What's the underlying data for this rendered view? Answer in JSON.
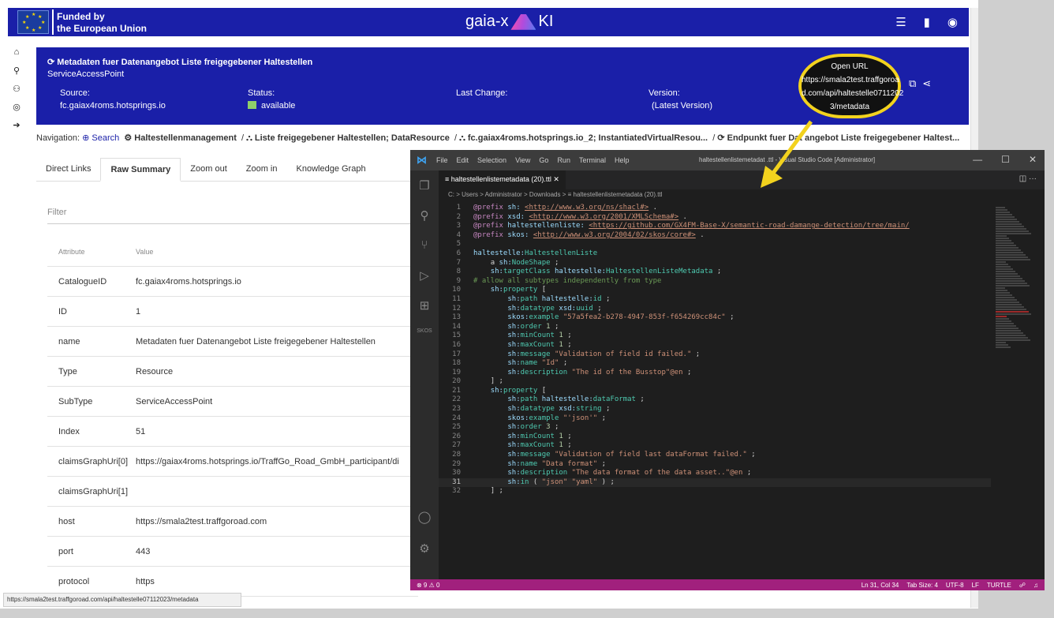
{
  "header": {
    "eu_line1": "Funded by",
    "eu_line2": "the European Union",
    "logo_left": "gaia-x",
    "logo_right": "KI",
    "icons": [
      "menu-icon",
      "document-icon",
      "user-icon"
    ]
  },
  "rail_icons": [
    "home-icon",
    "search-icon",
    "users-icon",
    "user-icon",
    "arrow-right-icon"
  ],
  "banner": {
    "title": "Metadaten fuer Datenangebot Liste freigegebener Haltestellen",
    "subtype": "ServiceAccessPoint",
    "source_label": "Source:",
    "source_value": "fc.gaiax4roms.hotsprings.io",
    "status_label": "Status:",
    "status_value": "available",
    "last_change_label": "Last Change:",
    "version_label": "Version:",
    "version_value": "(Latest Version)",
    "open_url_line1": "Open URL",
    "open_url_line2": "https://smala2test.traffgoroa",
    "open_url_line3": "d.com/api/haltestelle0711202",
    "open_url_line4": "3/metadata"
  },
  "nav": {
    "label": "Navigation:",
    "search": "Search",
    "crumb1": "Haltestellenmanagement",
    "crumb2": "Liste freigegebener Haltestellen; DataResource",
    "crumb3": "fc.gaiax4roms.hotsprings.io_2; InstantiatedVirtualResou...",
    "crumb4": "Endpunkt fuer Dat   angebot Liste freigegebener Haltest..."
  },
  "tabs": [
    "Direct Links",
    "Raw Summary",
    "Zoom out",
    "Zoom in",
    "Knowledge Graph"
  ],
  "filter_placeholder": "Filter",
  "table": {
    "head": [
      "Attribute",
      "Value"
    ],
    "rows": [
      [
        "CatalogueID",
        "fc.gaiax4roms.hotsprings.io"
      ],
      [
        "ID",
        "1"
      ],
      [
        "name",
        "Metadaten fuer Datenangebot Liste freigegebener Haltestellen"
      ],
      [
        "Type",
        "Resource"
      ],
      [
        "SubType",
        "ServiceAccessPoint"
      ],
      [
        "Index",
        "51"
      ],
      [
        "claimsGraphUri[0]",
        "https://gaiax4roms.hotsprings.io/TraffGo_Road_GmbH_participant/di"
      ],
      [
        "claimsGraphUri[1]",
        ""
      ],
      [
        "host",
        "https://smala2test.traffgoroad.com"
      ],
      [
        "port",
        "443"
      ],
      [
        "protocol",
        "https"
      ]
    ]
  },
  "status_url": "https://smala2test.traffgoroad.com/api/haltestelle07112023/metadata",
  "vscode": {
    "menu": [
      "File",
      "Edit",
      "Selection",
      "View",
      "Go",
      "Run",
      "Terminal",
      "Help"
    ],
    "window_title": "haltestellenlistemetadat   .ttl - Visual Studio Code [Administrator]",
    "tab": "haltestellenlistemetadata (20).ttl",
    "breadcrumb": "C: > Users > Administrator > Downloads > ≡ haltestellenlistemetadata (20).ttl",
    "status_left": "⊗ 9 ⚠ 0",
    "status_right": [
      "Ln 31, Col 34",
      "Tab Size: 4",
      "UTF-8",
      "LF",
      "TURTLE"
    ]
  },
  "code_lines": [
    "@prefix sh: <http://www.w3.org/ns/shacl#> .",
    "@prefix xsd: <http://www.w3.org/2001/XMLSchema#> .",
    "@prefix haltestellenliste: <https://github.com/GX4FM-Base-X/semantic-road-damange-detection/tree/main/",
    "@prefix skos: <http://www.w3.org/2004/02/skos/core#> .",
    "",
    "haltestelle:HaltestellenListe",
    "    a sh:NodeShape ;",
    "    sh:targetClass haltestelle:HaltestellenListeMetadata ;",
    "# allow all subtypes independently from type",
    "    sh:property [",
    "        sh:path haltestelle:id ;",
    "        sh:datatype xsd:uuid ;",
    "        skos:example \"57a5fea2-b278-4947-853f-f654269cc84c\" ;",
    "        sh:order 1 ;",
    "        sh:minCount 1 ;",
    "        sh:maxCount 1 ;",
    "        sh:message \"Validation of field id failed.\" ;",
    "        sh:name \"Id\" ;",
    "        sh:description \"The id of the Busstop\"@en ;",
    "    ] ;",
    "    sh:property [",
    "        sh:path haltestelle:dataFormat ;",
    "        sh:datatype xsd:string ;",
    "        skos:example \"'json'\" ;",
    "        sh:order 3 ;",
    "        sh:minCount 1 ;",
    "        sh:maxCount 1 ;",
    "        sh:message \"Validation of field last dataFormat failed.\" ;",
    "        sh:name \"Data format\" ;",
    "        sh:description \"The data format of the data asset..\"@en ;",
    "        sh:in ( \"json\" \"yaml\" ) ;",
    "    ] ;"
  ]
}
